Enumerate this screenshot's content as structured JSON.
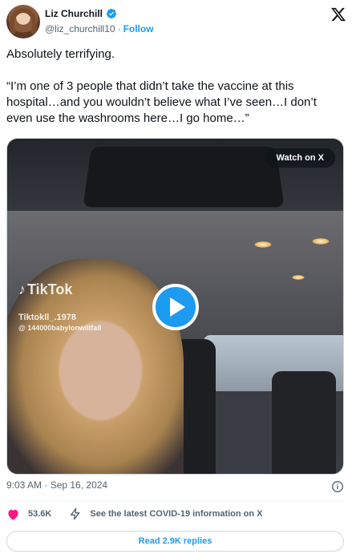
{
  "author": {
    "name": "Liz Churchill",
    "handle": "@liz_churchill10",
    "separator": "·",
    "follow_label": "Follow",
    "verified": true
  },
  "tweet": {
    "line1": "Absolutely terrifying.",
    "line2": "“I’m one of 3 people that didn’t take the vaccine at this hospital…and you wouldn’t believe what I’ve seen…I don’t even use the washrooms here…I go home…”"
  },
  "media": {
    "watch_label": "Watch on X",
    "overlay_brand": "TikTok",
    "overlay_user": "Tiktokll_.1978",
    "overlay_sub": "@ 144000babylonwillfall"
  },
  "meta": {
    "timestamp": "9:03 AM · Sep 16, 2024"
  },
  "actions": {
    "likes": "53.6K",
    "covid_info": "See the latest COVID-19 information on X"
  },
  "replies": {
    "label": "Read 2.9K replies"
  },
  "colors": {
    "accent": "#1d9bf0",
    "like": "#f91880",
    "text": "#0f1419",
    "muted": "#536471"
  }
}
